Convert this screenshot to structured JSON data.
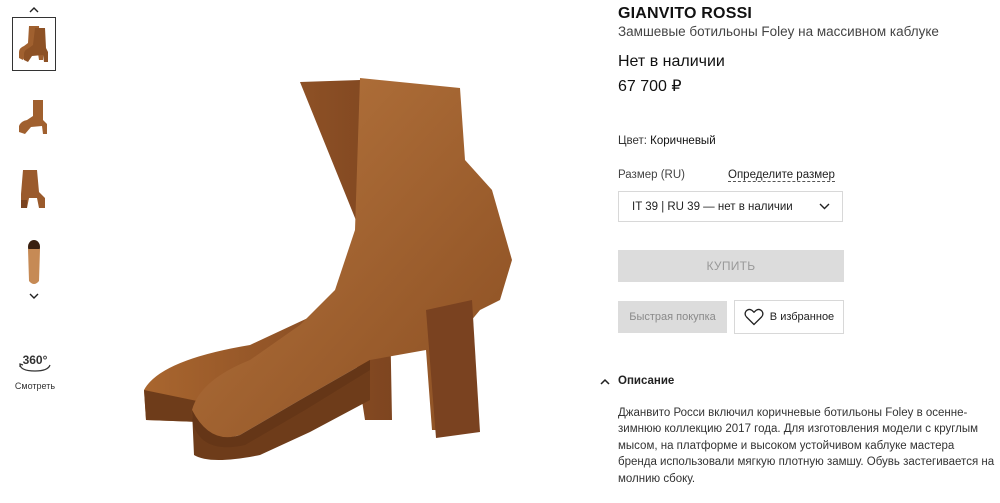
{
  "gallery": {
    "up_icon": "chevron-up-icon",
    "down_icon": "chevron-down-icon",
    "view360": {
      "badge": "360°",
      "label": "Смотреть"
    }
  },
  "product": {
    "brand": "GIANVITO ROSSI",
    "title": "Замшевые ботильоны Foley на массивном каблуке",
    "availability": "Нет в наличии",
    "price": "67 700 ₽",
    "color_label": "Цвет:",
    "color_value": "Коричневый"
  },
  "size": {
    "label": "Размер (RU)",
    "guide_link": "Определите размер",
    "selected": "IT 39 | RU 39 — нет в наличии"
  },
  "actions": {
    "buy": "КУПИТЬ",
    "quick_buy": "Быстрая покупка",
    "favorite": "В избранное"
  },
  "description": {
    "heading": "Описание",
    "text": "Джанвито Росси включил коричневые ботильоны Foley в осенне-зимнюю коллекцию 2017 года. Для изготовления модели с круглым мысом, на платформе и высоком устойчивом каблуке мастера бренда использовали мягкую плотную замшу. Обувь застегивается на молнию сбоку."
  },
  "colors": {
    "suede": "#9a5a2c",
    "suede_light": "#b8773f",
    "suede_dark": "#6e3c1a",
    "button_disabled": "#dcdcdc"
  }
}
